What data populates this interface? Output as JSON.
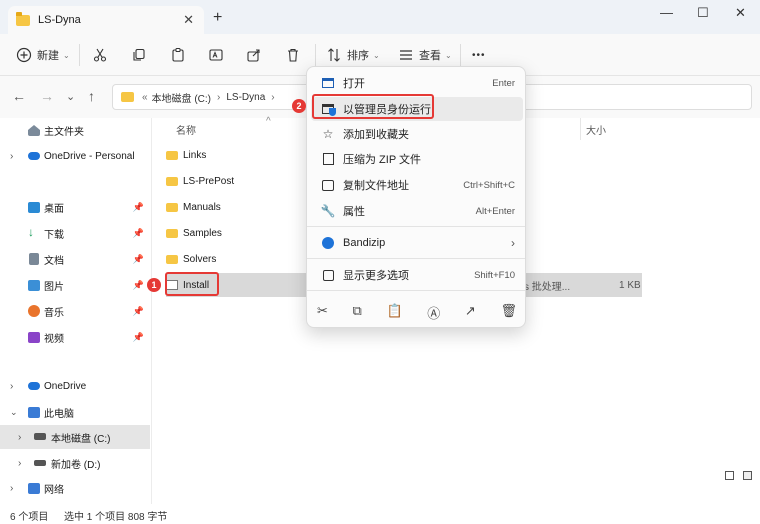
{
  "window": {
    "tab_title": "LS-Dyna",
    "tab_close": "✕",
    "new_tab": "+",
    "minimize": "—",
    "maximize": "☐",
    "close": "✕"
  },
  "toolbar": {
    "new_label": "新建",
    "sort_label": "排序",
    "view_label": "查看",
    "more": "•••"
  },
  "address": {
    "prefix": "«",
    "crumbs": [
      "本地磁盘 (C:)",
      "LS-Dyna"
    ],
    "sep": "›"
  },
  "sidebar": {
    "items": [
      {
        "label": "主文件夹",
        "icon": "home-icon"
      },
      {
        "label": "OneDrive - Personal",
        "icon": "onedrive-icon"
      },
      {
        "label": "桌面",
        "icon": "desktop-icon",
        "pinned": true
      },
      {
        "label": "下载",
        "icon": "download-icon",
        "pinned": true
      },
      {
        "label": "文档",
        "icon": "documents-icon",
        "pinned": true
      },
      {
        "label": "图片",
        "icon": "pictures-icon",
        "pinned": true
      },
      {
        "label": "音乐",
        "icon": "music-icon",
        "pinned": true
      },
      {
        "label": "视频",
        "icon": "videos-icon",
        "pinned": true
      },
      {
        "label": "OneDrive",
        "icon": "onedrive-icon"
      },
      {
        "label": "此电脑",
        "icon": "pc-icon"
      },
      {
        "label": "本地磁盘 (C:)",
        "icon": "drive-icon"
      },
      {
        "label": "新加卷 (D:)",
        "icon": "drive-icon"
      },
      {
        "label": "网络",
        "icon": "network-icon"
      }
    ]
  },
  "content": {
    "col_name": "名称",
    "col_size": "大小",
    "rows": [
      {
        "name": "Links"
      },
      {
        "name": "LS-PrePost"
      },
      {
        "name": "Manuals"
      },
      {
        "name": "Samples"
      },
      {
        "name": "Solvers"
      },
      {
        "name": "Install",
        "type": "s 批处理...",
        "size": "1 KB"
      }
    ]
  },
  "context_menu": {
    "items": [
      {
        "label": "打开",
        "shortcut": "Enter",
        "icon": "open-icon"
      },
      {
        "label": "以管理员身份运行",
        "shortcut": "",
        "icon": "shield-icon"
      },
      {
        "label": "添加到收藏夹",
        "shortcut": "",
        "icon": "star-icon"
      },
      {
        "label": "压缩为 ZIP 文件",
        "shortcut": "",
        "icon": "zip-icon"
      },
      {
        "label": "复制文件地址",
        "shortcut": "Ctrl+Shift+C",
        "icon": "copy-path-icon"
      },
      {
        "label": "属性",
        "shortcut": "Alt+Enter",
        "icon": "wrench-icon"
      },
      {
        "label": "Bandizip",
        "shortcut": "",
        "icon": "bandizip-icon",
        "arrow": "›"
      },
      {
        "label": "显示更多选项",
        "shortcut": "Shift+F10",
        "icon": "more-options-icon"
      }
    ]
  },
  "annotations": {
    "badge1": "1",
    "badge2": "2"
  },
  "status": {
    "count": "6 个项目",
    "selection": "选中 1 个项目  808 字节"
  },
  "colors": {
    "accent_red": "#e53935",
    "folder": "#f6c644",
    "onedrive": "#1e73d8"
  }
}
